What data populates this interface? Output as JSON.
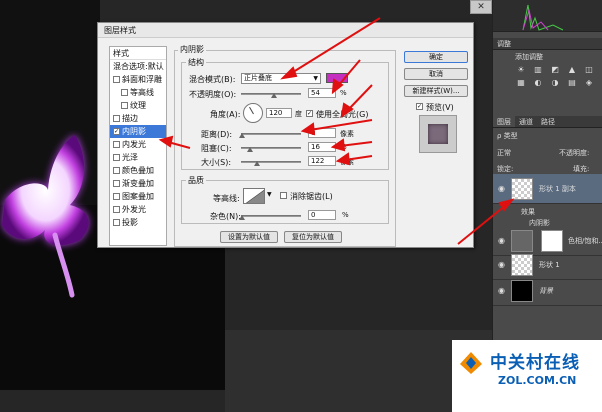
{
  "dialog": {
    "title": "图层样式",
    "styles_header": "样式",
    "blend_default": "混合选项:默认",
    "styles": [
      {
        "label": "斜面和浮雕",
        "checked": false,
        "indent": false
      },
      {
        "label": "等高线",
        "checked": false,
        "indent": true
      },
      {
        "label": "纹理",
        "checked": false,
        "indent": true
      },
      {
        "label": "描边",
        "checked": false,
        "indent": false
      },
      {
        "label": "内阴影",
        "checked": true,
        "indent": false,
        "selected": true
      },
      {
        "label": "内发光",
        "checked": false,
        "indent": false
      },
      {
        "label": "光泽",
        "checked": false,
        "indent": false
      },
      {
        "label": "颜色叠加",
        "checked": false,
        "indent": false
      },
      {
        "label": "渐变叠加",
        "checked": false,
        "indent": false
      },
      {
        "label": "图案叠加",
        "checked": false,
        "indent": false
      },
      {
        "label": "外发光",
        "checked": false,
        "indent": false
      },
      {
        "label": "投影",
        "checked": false,
        "indent": false
      }
    ],
    "section_title": "内阴影",
    "structure_title": "结构",
    "blend_mode_label": "混合模式(B):",
    "blend_mode_value": "正片叠底",
    "shadow_color": "#c42fc0",
    "opacity_label": "不透明度(O):",
    "opacity_value": "54",
    "angle_label": "角度(A):",
    "angle_value": "120",
    "degree_unit": "度",
    "global_light_label": "使用全局光(G)",
    "global_light_checked": true,
    "distance_label": "距离(D):",
    "distance_value": "0",
    "choke_label": "阻塞(C):",
    "choke_value": "16",
    "size_label": "大小(S):",
    "size_value": "122",
    "percent_unit": "%",
    "pixel_unit": "像素",
    "quality_title": "品质",
    "contour_label": "等高线:",
    "antialias_label": "消除锯齿(L)",
    "noise_label": "杂色(N):",
    "noise_value": "0",
    "make_default": "设置为默认值",
    "reset_default": "复位为默认值",
    "ok": "确定",
    "cancel": "取消",
    "new_style": "新建样式(W)...",
    "preview_label": "预览(V)",
    "preview_checked": true
  },
  "panel": {
    "adjust_title": "调整",
    "adjust_subtitle": "添加调整",
    "adjust_icons": [
      "☀",
      "▥",
      "◩",
      "▲",
      "◫",
      "▦",
      "◐",
      "◑",
      "▤",
      "◈"
    ],
    "tabs": [
      "图层",
      "通道",
      "路径"
    ],
    "filter_label": "ρ 类型",
    "mode_label": "正常",
    "opacity_label": "不透明度:",
    "lock_label": "锁定:",
    "fill_label": "填充:",
    "layers": [
      {
        "name": "形状 1 副本",
        "thumb": "check",
        "selected": true
      },
      {
        "name": "效果",
        "sub": true
      },
      {
        "name": "内阴影",
        "sub": true
      },
      {
        "name": "色相/饱和...",
        "thumb": "white"
      },
      {
        "name": "形状 1",
        "thumb": "check"
      },
      {
        "name": "背景",
        "thumb": "black"
      }
    ]
  },
  "watermark": {
    "cn": "中关村在线",
    "en": "ZOL.COM.CN"
  }
}
